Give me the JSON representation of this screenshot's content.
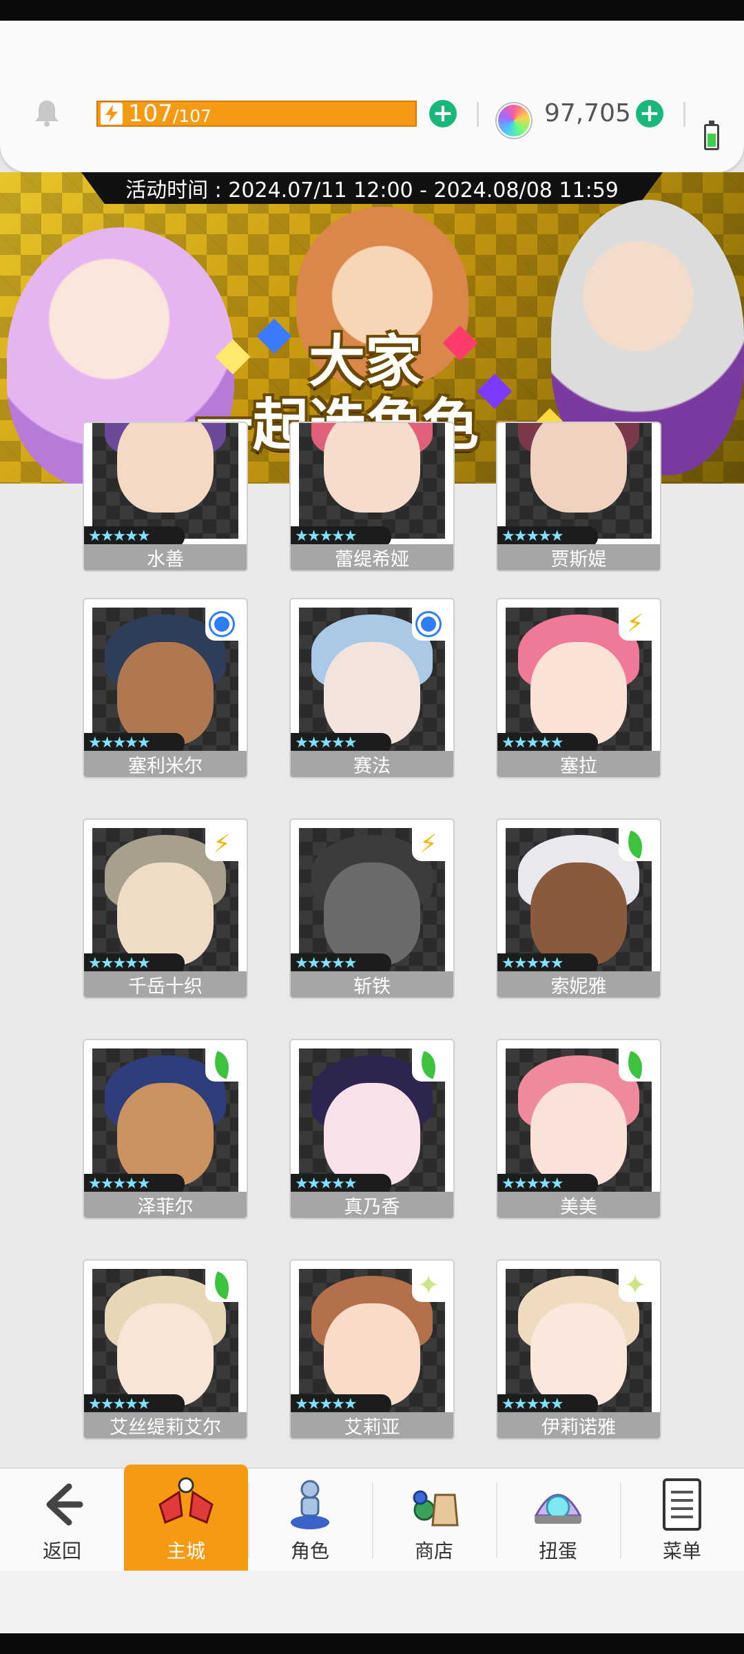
{
  "top_bar": {
    "stamina_current": "107",
    "stamina_max": "/107",
    "gem_count": "97,705"
  },
  "banner": {
    "event_time": "活动时间 : 2024.07/11 12:00 - 2024.08/08 11:59",
    "title_line1": "大家",
    "title_line2": "一起选角色"
  },
  "characters": [
    {
      "name": "水善",
      "element": "none"
    },
    {
      "name": "蕾缇希娅",
      "element": "none"
    },
    {
      "name": "贾斯媞",
      "element": "none"
    },
    {
      "name": "塞利米尔",
      "element": "water"
    },
    {
      "name": "赛法",
      "element": "water"
    },
    {
      "name": "塞拉",
      "element": "thunder"
    },
    {
      "name": "千岳十织",
      "element": "thunder"
    },
    {
      "name": "斩铁",
      "element": "thunder"
    },
    {
      "name": "索妮雅",
      "element": "earth"
    },
    {
      "name": "泽菲尔",
      "element": "earth"
    },
    {
      "name": "真乃香",
      "element": "earth"
    },
    {
      "name": "美美",
      "element": "earth"
    },
    {
      "name": "艾丝缇莉艾尔",
      "element": "earth"
    },
    {
      "name": "艾莉亚",
      "element": "light"
    },
    {
      "name": "伊莉诺雅",
      "element": "light"
    }
  ],
  "stars": "★★★★★",
  "bottom_nav": {
    "back": "返回",
    "home": "主城",
    "characters": "角色",
    "shop": "商店",
    "gacha": "扭蛋",
    "menu": "菜单"
  },
  "colors": {
    "accent": "#f59a12",
    "plus": "#19b87a",
    "water": "#2d7cf0",
    "thunder": "#f4b400",
    "earth": "#3cc23c",
    "light": "#cfe58a"
  },
  "icons": {
    "notification": "bell-icon",
    "stamina": "lightning-icon",
    "currency": "rainbow-gem-icon",
    "battery": "battery-icon",
    "back": "arrow-left-icon",
    "home": "home-castle-icon",
    "characters": "character-figure-icon",
    "shop": "shop-bag-icon",
    "gacha": "gacha-machine-icon",
    "menu": "menu-list-icon"
  }
}
